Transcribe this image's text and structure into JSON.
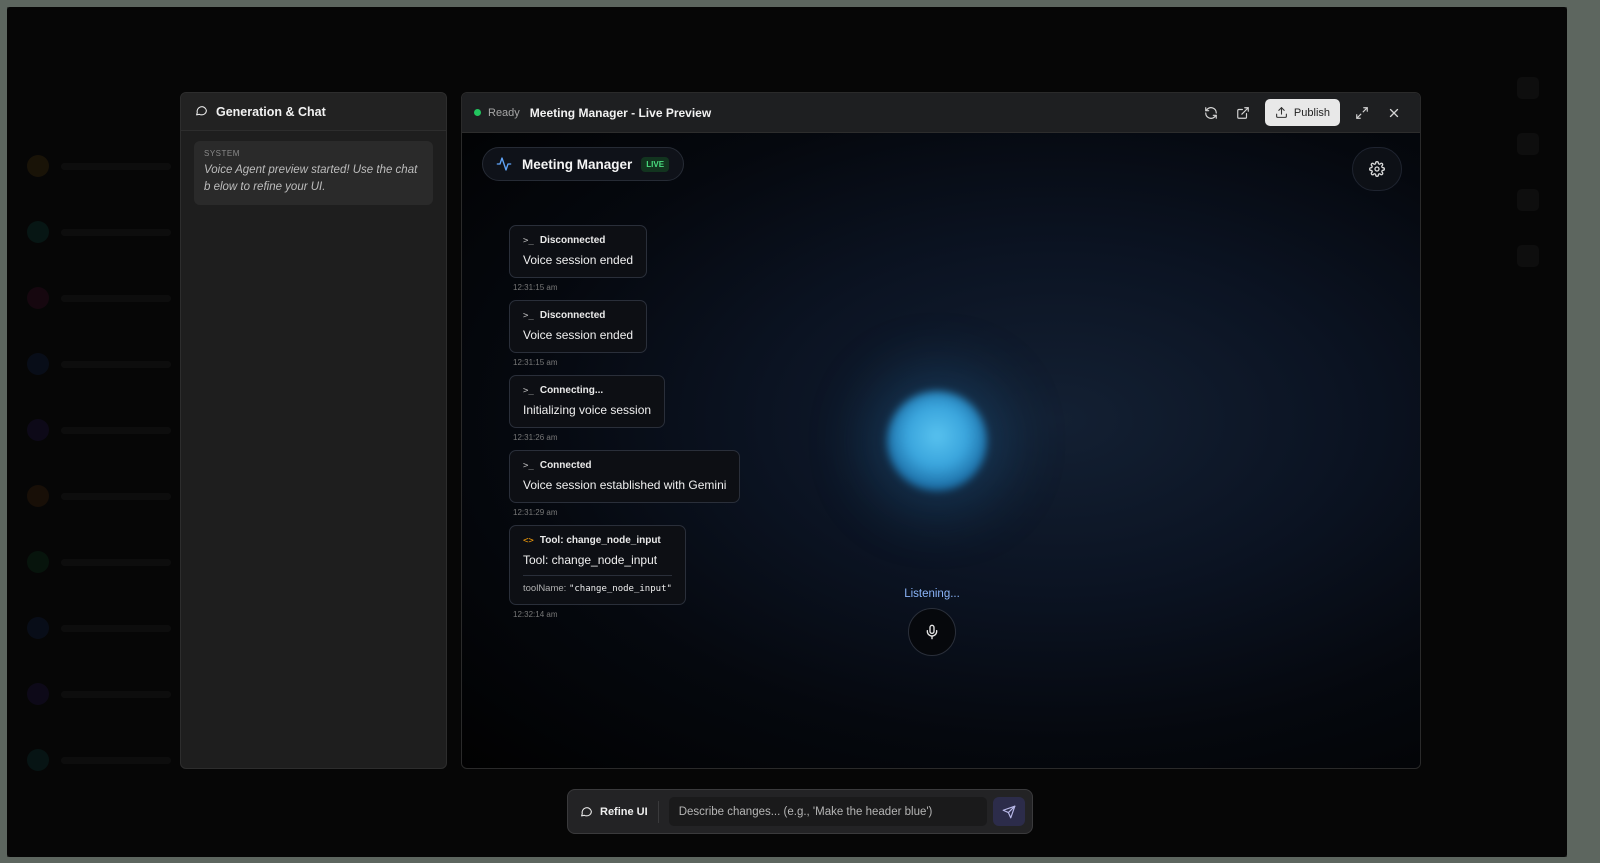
{
  "chat_panel": {
    "title": "Generation & Chat",
    "system_message": {
      "label": "SYSTEM",
      "text": "Voice Agent preview started! Use the chat b elow to refine your UI."
    }
  },
  "preview": {
    "status": "Ready",
    "status_color": "#22c55e",
    "title": "Meeting Manager - Live Preview",
    "publish_label": "Publish",
    "app_name": "Meeting Manager",
    "live_badge": "LIVE",
    "listening_text": "Listening...",
    "messages": [
      {
        "icon": "terminal-icon",
        "header": "Disconnected",
        "body": "Voice session ended",
        "time": "12:31:15 am"
      },
      {
        "icon": "terminal-icon",
        "header": "Disconnected",
        "body": "Voice session ended",
        "time": "12:31:15 am"
      },
      {
        "icon": "terminal-icon",
        "header": "Connecting...",
        "body": "Initializing voice session",
        "time": "12:31:26 am"
      },
      {
        "icon": "terminal-icon",
        "header": "Connected",
        "body": "Voice session established with Gemini",
        "time": "12:31:29 am"
      },
      {
        "icon": "code-icon",
        "header": "Tool: change_node_input",
        "body": "Tool: change_node_input",
        "meta_key": "toolName:",
        "meta_value": "\"change_node_input\"",
        "time": "12:32:14 am"
      }
    ]
  },
  "refine_bar": {
    "label": "Refine UI",
    "placeholder": "Describe changes... (e.g., 'Make the header blue')"
  },
  "colors": {
    "accent_orb": "#3aa5dd",
    "listening": "#8ab4f8",
    "live_badge": "#4ade80",
    "tool_icon": "#f59e0b"
  }
}
